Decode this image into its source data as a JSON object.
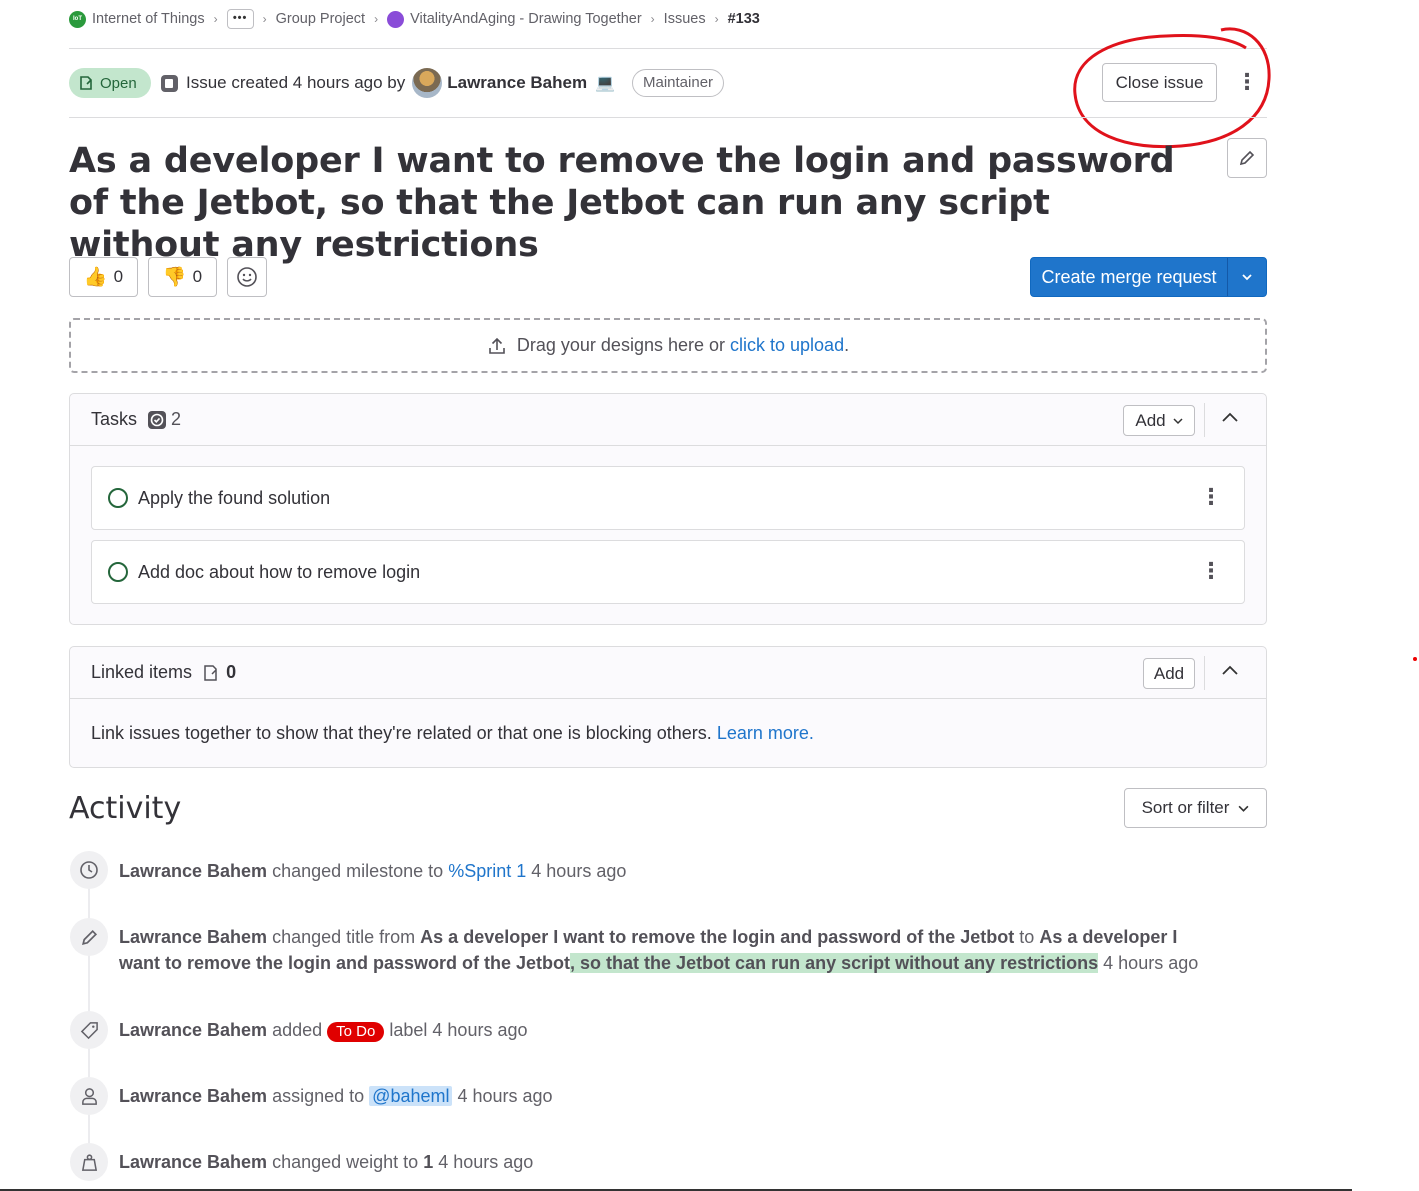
{
  "breadcrumb": {
    "group_avatar": "IoT",
    "group": "Internet of Things",
    "more": "•••",
    "subgroup": "Group Project",
    "project": "VitalityAndAging - Drawing Together",
    "section": "Issues",
    "current": "#133"
  },
  "header": {
    "status": "Open",
    "created_text": "Issue created 4 hours ago by",
    "author": "Lawrance Bahem",
    "role": "Maintainer",
    "close_button": "Close issue"
  },
  "issue": {
    "title": "As a developer I want to remove the login and password of the Jetbot, so that the Jetbot can run any script without any restrictions"
  },
  "awards": {
    "thumbs_up": "0",
    "thumbs_down": "0"
  },
  "actions": {
    "create_mr": "Create merge request"
  },
  "designs": {
    "prompt": "Drag your designs here or",
    "upload_link": "click to upload",
    "period": "."
  },
  "tasks": {
    "heading": "Tasks",
    "count": "2",
    "add_button": "Add",
    "items": [
      {
        "label": "Apply the found solution"
      },
      {
        "label": "Add doc about how to remove login"
      }
    ]
  },
  "linked": {
    "heading": "Linked items",
    "count": "0",
    "add_button": "Add",
    "description": "Link issues together to show that they're related or that one is blocking others.",
    "learn_more": "Learn more."
  },
  "activity": {
    "heading": "Activity",
    "sort_button": "Sort or filter",
    "events": [
      {
        "user": "Lawrance Bahem",
        "text1": "changed milestone to",
        "link": "%Sprint 1",
        "time": "4 hours ago"
      },
      {
        "user": "Lawrance Bahem",
        "text1": "changed title from",
        "old": "As a developer I want to remove the login and password of the Jetbot",
        "text2": "to",
        "new_a": "As a developer I want to remove the login and password of the Jetbot",
        "new_b": ", so that the Jetbot can run any script without any restrictions",
        "time": "4 hours ago"
      },
      {
        "user": "Lawrance Bahem",
        "text1": "added",
        "label": "To Do",
        "text2": "label",
        "time": "4 hours ago"
      },
      {
        "user": "Lawrance Bahem",
        "text1": "assigned to",
        "mention": "@baheml",
        "time": "4 hours ago"
      },
      {
        "user": "Lawrance Bahem",
        "text1": "changed weight to",
        "weight": "1",
        "time": "4 hours ago"
      }
    ]
  },
  "colors": {
    "primary": "#1f75cb",
    "open_bg": "#c3e6cd",
    "open_text": "#24663b",
    "todo_label": "#e00000",
    "annotation": "#e0121b"
  }
}
